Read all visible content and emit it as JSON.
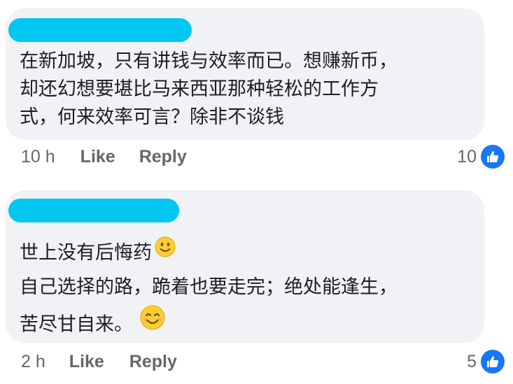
{
  "comments": [
    {
      "lines": [
        "在新加坡，只有讲钱与效率而已。想赚新币，",
        "却还幻想要堪比马来西亚那种轻松的工作方",
        "式，何来效率可言？除非不谈钱"
      ],
      "time": "10 h",
      "like_label": "Like",
      "reply_label": "Reply",
      "reaction_count": "10"
    },
    {
      "lines": [
        "世上没有后悔药",
        "自己选择的路，跪着也要走完；绝处能逢生，",
        "苦尽甘自来。"
      ],
      "time": "2 h",
      "like_label": "Like",
      "reply_label": "Reply",
      "reaction_count": "5"
    }
  ],
  "colors": {
    "bubble": "#f0f2f5",
    "redaction": "#00c6f0",
    "like_badge": "#1877f2",
    "meta_text": "#65676b"
  },
  "icons": {
    "slight_smile": "slightly-smiling-face-emoji",
    "smile": "smiling-face-with-smiling-eyes-emoji",
    "like": "thumbs-up-icon"
  }
}
